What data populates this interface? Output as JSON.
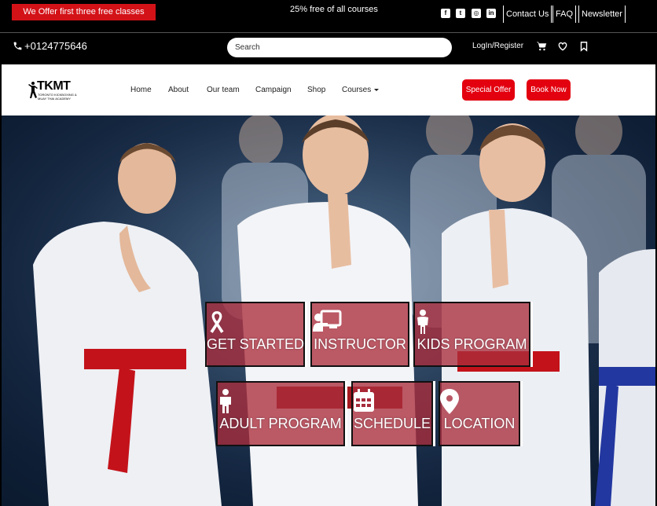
{
  "topbar": {
    "promo_button": "We Offer first three free classes",
    "free_text": "25% free of all courses",
    "social_icons": [
      "facebook-icon",
      "twitter-icon",
      "instagram-icon",
      "linkedin-icon"
    ],
    "links": [
      "Contact Us",
      "FAQ",
      "Newsletter"
    ]
  },
  "secondbar": {
    "phone": "+0124775646",
    "search_placeholder": "Search",
    "login": "LogIn/Register",
    "icons": [
      "cart-icon",
      "heart-icon",
      "bookmark-icon"
    ]
  },
  "navbar": {
    "logo_text": "TKMT",
    "logo_sub": "TORONTO KICKBOXING & MUAY THAI ACADEMY",
    "items": [
      "Home",
      "About",
      "Our team",
      "Campaign",
      "Shop",
      "Courses"
    ],
    "special_offer": "Special Offer",
    "book_now": "Book Now"
  },
  "tiles": [
    {
      "label": "GET STARTED",
      "icon": "ribbon-icon"
    },
    {
      "label": "INSTRUCTOR",
      "icon": "instructor-icon"
    },
    {
      "label": "KIDS PROGRAM",
      "icon": "child-icon"
    },
    {
      "label": "ADULT PROGRAM",
      "icon": "person-icon"
    },
    {
      "label": "SCHEDULE",
      "icon": "calendar-icon"
    },
    {
      "label": "LOCATION",
      "icon": "location-pin-icon"
    }
  ],
  "colors": {
    "accent_red": "#e3000f",
    "promo_red": "#d31218",
    "tile_red": "#aa2d3c"
  }
}
